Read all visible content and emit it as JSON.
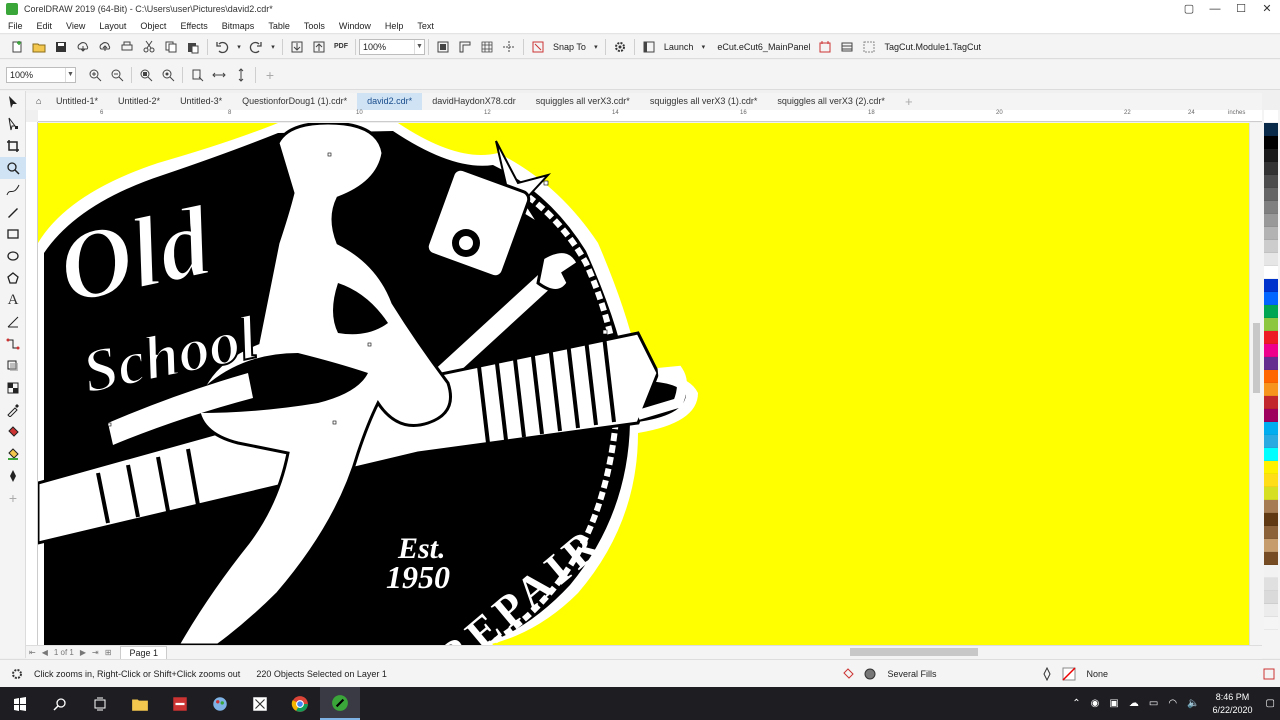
{
  "window": {
    "title": "CorelDRAW 2019 (64-Bit) - C:\\Users\\user\\Pictures\\david2.cdr*",
    "controls": [
      "▢",
      "—",
      "☐",
      "✕"
    ]
  },
  "menu": [
    "File",
    "Edit",
    "View",
    "Layout",
    "Object",
    "Effects",
    "Bitmaps",
    "Table",
    "Tools",
    "Window",
    "Help",
    "Text"
  ],
  "standard_toolbar": {
    "zoom_level": "100%",
    "snap_to_label": "Snap To",
    "launch_label": "Launch",
    "ecut_label": "eCut.eCut6_MainPanel",
    "tagcut_label": "TagCut.Module1.TagCut"
  },
  "property_bar": {
    "zoom_level": "100%"
  },
  "document_tabs": [
    {
      "label": "Untitled-1*",
      "active": false
    },
    {
      "label": "Untitled-2*",
      "active": false
    },
    {
      "label": "Untitled-3*",
      "active": false
    },
    {
      "label": "QuestionforDoug1 (1).cdr*",
      "active": false
    },
    {
      "label": "david2.cdr*",
      "active": true
    },
    {
      "label": "davidHaydonX78.cdr",
      "active": false
    },
    {
      "label": "squiggles all verX3.cdr*",
      "active": false
    },
    {
      "label": "squiggles all verX3 (1).cdr*",
      "active": false
    },
    {
      "label": "squiggles all verX3 (2).cdr*",
      "active": false
    }
  ],
  "ruler": {
    "labels": [
      "6",
      "8",
      "10",
      "12",
      "14",
      "16",
      "18",
      "20",
      "22",
      "24"
    ],
    "units": "inches"
  },
  "artwork": {
    "line1": "Old",
    "line2": "School",
    "est": "Est.",
    "year": "1950",
    "arc_text": "REPAIR",
    "background_color": "#ffff00"
  },
  "page_nav": {
    "position": "1 of 1",
    "page_label": "Page 1"
  },
  "status": {
    "hint": "Click zooms in, Right-Click or Shift+Click zooms out",
    "selection": "220 Objects Selected on Layer 1",
    "fill": "Several Fills",
    "outline": "None"
  },
  "palette": [
    "#ffffff",
    "#0a2a4a",
    "#000000",
    "#1a1a1a",
    "#333333",
    "#4d4d4d",
    "#666666",
    "#808080",
    "#999999",
    "#b3b3b3",
    "#cccccc",
    "#e6e6e6",
    "#ffffff",
    "#0033cc",
    "#0066ff",
    "#00a651",
    "#8dc63f",
    "#ed1c24",
    "#ec008c",
    "#662d91",
    "#ff6600",
    "#f7941d",
    "#c1272d",
    "#9e005d",
    "#00aeef",
    "#29abe2",
    "#00ffff",
    "#fff200",
    "#ffde17",
    "#d7df23",
    "#a67c52",
    "#603913",
    "#8c6239",
    "#c69c6d",
    "#754c24",
    "#f2f2f2",
    "#e0e0e0",
    "#dadada",
    "#ececec",
    "#f5f5f5"
  ],
  "taskbar": {
    "time": "8:46 PM",
    "date": "6/22/2020"
  }
}
